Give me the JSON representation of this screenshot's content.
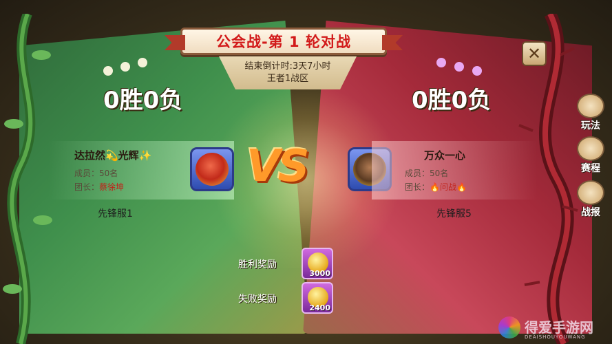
{
  "title": "公会战-第 1 轮对战",
  "countdown": "结束倒计时:3天7小时",
  "zone": "王者1战区",
  "close_icon": "close-icon",
  "left_guild": {
    "score": "0胜0负",
    "name": "达拉然💫光辉✨",
    "members": "成员：50名",
    "leader_label": "团长：",
    "leader_name": "蔡徐坤",
    "server": "先锋服1"
  },
  "right_guild": {
    "score": "0胜0负",
    "name": "万众一心",
    "members": "成员：50名",
    "leader_label": "团长：",
    "leader_name": "🔥问战🔥",
    "server": "先锋服5"
  },
  "vs_text": "VS",
  "rewards": {
    "win_label": "胜利奖励",
    "win_amount": "3000",
    "lose_label": "失败奖励",
    "lose_amount": "2400"
  },
  "side_menu": [
    {
      "label": "玩法",
      "icon": "book-icon"
    },
    {
      "label": "赛程",
      "icon": "flame-icon"
    },
    {
      "label": "战报",
      "icon": "battle-report-icon"
    }
  ],
  "watermark": {
    "text": "得爱手游网",
    "en": "DEAISHOUYOUWANG"
  },
  "colors": {
    "left_team": "#3f8f4c",
    "right_team": "#a42a3a",
    "title_red": "#d21a1a"
  }
}
